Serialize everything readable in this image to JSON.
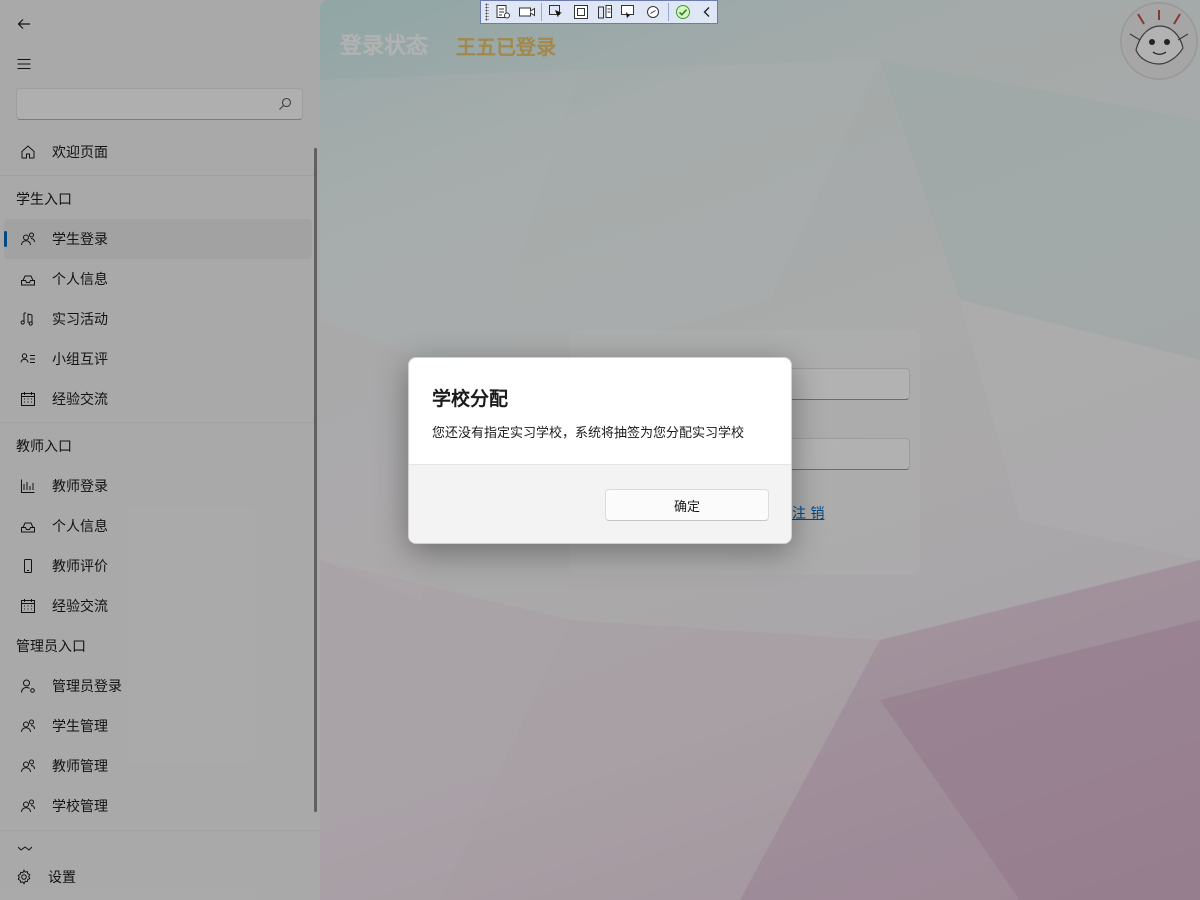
{
  "sidebar": {
    "search_placeholder": "",
    "welcome": "欢迎页面",
    "groups": [
      {
        "header": "学生入口",
        "items": [
          {
            "label": "学生登录",
            "icon": "people-icon",
            "selected": true
          },
          {
            "label": "个人信息",
            "icon": "tray-icon"
          },
          {
            "label": "实习活动",
            "icon": "music-notes-icon"
          },
          {
            "label": "小组互评",
            "icon": "person-list-icon"
          },
          {
            "label": "经验交流",
            "icon": "calendar-icon"
          }
        ]
      },
      {
        "header": "教师入口",
        "items": [
          {
            "label": "教师登录",
            "icon": "ruler-chart-icon"
          },
          {
            "label": "个人信息",
            "icon": "tray-icon"
          },
          {
            "label": "教师评价",
            "icon": "phone-icon"
          },
          {
            "label": "经验交流",
            "icon": "calendar-icon"
          }
        ]
      },
      {
        "header": "管理员入口",
        "items": [
          {
            "label": "管理员登录",
            "icon": "admin-person-icon"
          },
          {
            "label": "学生管理",
            "icon": "people-icon"
          },
          {
            "label": "教师管理",
            "icon": "people-icon"
          },
          {
            "label": "学校管理",
            "icon": "people-icon"
          }
        ]
      }
    ],
    "settings": "设置"
  },
  "main": {
    "status_title": "登录状态",
    "status_user": "王五已登录",
    "logout": "注 销"
  },
  "dialog": {
    "title": "学校分配",
    "message": "您还没有指定实习学校，系统将抽签为您分配实习学校",
    "ok": "确定"
  },
  "colors": {
    "accent": "#0067c0",
    "status_user": "#e8c36a"
  }
}
